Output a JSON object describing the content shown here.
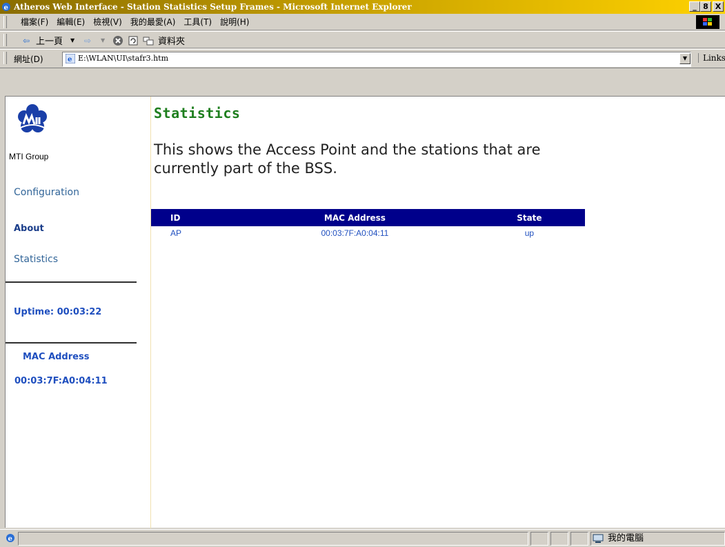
{
  "window": {
    "title": "Atheros Web Interface - Station Statistics Setup Frames - Microsoft Internet Explorer",
    "buttons": [
      "_",
      "8",
      "X"
    ]
  },
  "menu": {
    "items": [
      "檔案(F)",
      "編輯(E)",
      "檢視(V)",
      "我的最愛(A)",
      "工具(T)",
      "說明(H)"
    ]
  },
  "toolbar": {
    "back_label": "上一頁",
    "folders_label": "資料夾"
  },
  "address": {
    "label": "網址(D)",
    "value": "E:\\WLAN\\UI\\stafr3.htm",
    "links_label": "Links"
  },
  "sidebar": {
    "logo_caption": "MTI Group",
    "nav": {
      "configuration": "Configuration",
      "about": "About",
      "statistics": "Statistics"
    },
    "uptime": "Uptime: 00:03:22",
    "mac_heading": "MAC Address",
    "mac_value": "00:03:7F:A0:04:11"
  },
  "main": {
    "title": "Statistics",
    "description": "This shows the Access Point and the stations that are currently part of the BSS.",
    "table": {
      "headers": {
        "id": "ID",
        "mac": "MAC Address",
        "state": "State"
      },
      "rows": [
        {
          "id": "AP",
          "mac": "00:03:7F:A0:04:11",
          "state": "up"
        }
      ]
    }
  },
  "statusbar": {
    "zone": "我的電腦"
  },
  "colors": {
    "title_green": "#1f7f1f",
    "table_header": "#00008b",
    "link_blue": "#336699",
    "accent_blue": "#1f4fbf"
  }
}
